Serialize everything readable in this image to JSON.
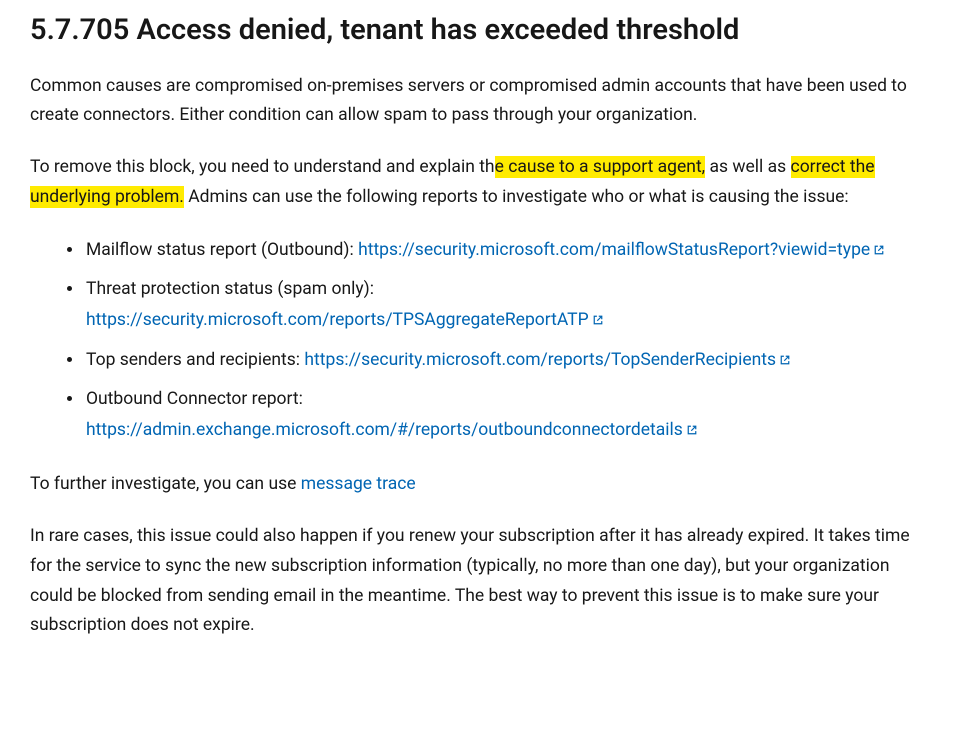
{
  "heading": "5.7.705 Access denied, tenant has exceeded threshold",
  "p1": "Common causes are compromised on-premises servers or compromised admin accounts that have been used to create connectors. Either condition can allow spam to pass through your organization.",
  "p2": {
    "pre": "To remove this block, you need to understand and explain th",
    "hl1": "e cause to a support agent,",
    "mid": " as well as ",
    "hl2": "correct the underlying problem.",
    "post": " Admins can use the following reports to investigate who or what is causing the issue:"
  },
  "reports": [
    {
      "label": "Mailflow status report (Outbound): ",
      "link": "https://security.microsoft.com/mailflowStatusReport?viewid=type"
    },
    {
      "label": "Threat protection status (spam only): ",
      "link": "https://security.microsoft.com/reports/TPSAggregateReportATP"
    },
    {
      "label": "Top senders and recipients: ",
      "link": "https://security.microsoft.com/reports/TopSenderRecipients"
    },
    {
      "label": "Outbound Connector report: ",
      "link": "https://admin.exchange.microsoft.com/#/reports/outboundconnectordetails"
    }
  ],
  "p3": {
    "pre": "To further investigate, you can use ",
    "link": "message trace"
  },
  "p4": "In rare cases, this issue could also happen if you renew your subscription after it has already expired. It takes time for the service to sync the new subscription information (typically, no more than one day), but your organization could be blocked from sending email in the meantime. The best way to prevent this issue is to make sure your subscription does not expire.",
  "colors": {
    "link": "#0065b3",
    "highlight": "#ffeb00",
    "text": "#171717"
  }
}
